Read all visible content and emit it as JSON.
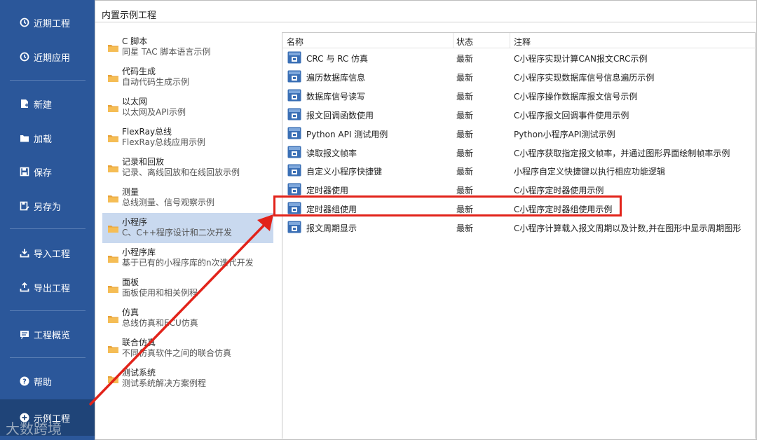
{
  "sidebar": {
    "items": [
      {
        "label": "近期工程",
        "icon": "history-icon"
      },
      {
        "label": "近期应用",
        "icon": "history-icon"
      },
      {
        "label": "新建",
        "icon": "new-file-icon"
      },
      {
        "label": "加载",
        "icon": "open-folder-icon"
      },
      {
        "label": "保存",
        "icon": "save-icon"
      },
      {
        "label": "另存为",
        "icon": "save-as-icon"
      },
      {
        "label": "导入工程",
        "icon": "import-icon"
      },
      {
        "label": "导出工程",
        "icon": "export-icon"
      },
      {
        "label": "工程概览",
        "icon": "overview-icon"
      },
      {
        "label": "帮助",
        "icon": "help-icon"
      },
      {
        "label": "示例工程",
        "icon": "add-circle-icon"
      }
    ]
  },
  "content": {
    "title": "内置示例工程"
  },
  "categories": [
    {
      "name": "C 脚本",
      "desc": "同星 TAC 脚本语言示例"
    },
    {
      "name": "代码生成",
      "desc": "自动代码生成示例"
    },
    {
      "name": "以太网",
      "desc": "以太网及API示例"
    },
    {
      "name": "FlexRay总线",
      "desc": "FlexRay总线应用示例"
    },
    {
      "name": "记录和回放",
      "desc": "记录、离线回放和在线回放示例"
    },
    {
      "name": "测量",
      "desc": "总线测量、信号观察示例"
    },
    {
      "name": "小程序",
      "desc": "C、C++程序设计和二次开发"
    },
    {
      "name": "小程序库",
      "desc": "基于已有的小程序库的n次迭代开发"
    },
    {
      "name": "面板",
      "desc": "面板使用和相关例程"
    },
    {
      "name": "仿真",
      "desc": "总线仿真和ECU仿真"
    },
    {
      "name": "联合仿真",
      "desc": "不同仿真软件之间的联合仿真"
    },
    {
      "name": "测试系统",
      "desc": "测试系统解决方案例程"
    }
  ],
  "table": {
    "headers": {
      "name": "名称",
      "status": "状态",
      "note": "注释"
    },
    "rows": [
      {
        "name": "CRC 与 RC 仿真",
        "status": "最新",
        "note": "C小程序实现计算CAN报文CRC示例"
      },
      {
        "name": "遍历数据库信息",
        "status": "最新",
        "note": "C小程序实现数据库信号信息遍历示例"
      },
      {
        "name": "数据库信号读写",
        "status": "最新",
        "note": "C小程序操作数据库报文信号示例"
      },
      {
        "name": "报文回调函数使用",
        "status": "最新",
        "note": "C小程序报文回调事件使用示例"
      },
      {
        "name": "Python API 测试用例",
        "status": "最新",
        "note": "Python小程序API测试示例"
      },
      {
        "name": "读取报文帧率",
        "status": "最新",
        "note": "C小程序获取指定报文帧率，并通过图形界面绘制帧率示例"
      },
      {
        "name": "自定义小程序快捷键",
        "status": "最新",
        "note": "小程序自定义快捷键以执行相应功能逻辑"
      },
      {
        "name": "定时器使用",
        "status": "最新",
        "note": "C小程序定时器使用示例"
      },
      {
        "name": "定时器组使用",
        "status": "最新",
        "note": "C小程序定时器组使用示例"
      },
      {
        "name": "报文周期显示",
        "status": "最新",
        "note": "C小程序计算载入报文周期以及计数,并在图形中显示周期图形"
      }
    ]
  },
  "watermark": "大数跨境",
  "colors": {
    "sidebar_bg": "#2b579a",
    "selected_bg": "#c9d9ef",
    "highlight": "#e2231a",
    "folder": "#e8a33a"
  }
}
